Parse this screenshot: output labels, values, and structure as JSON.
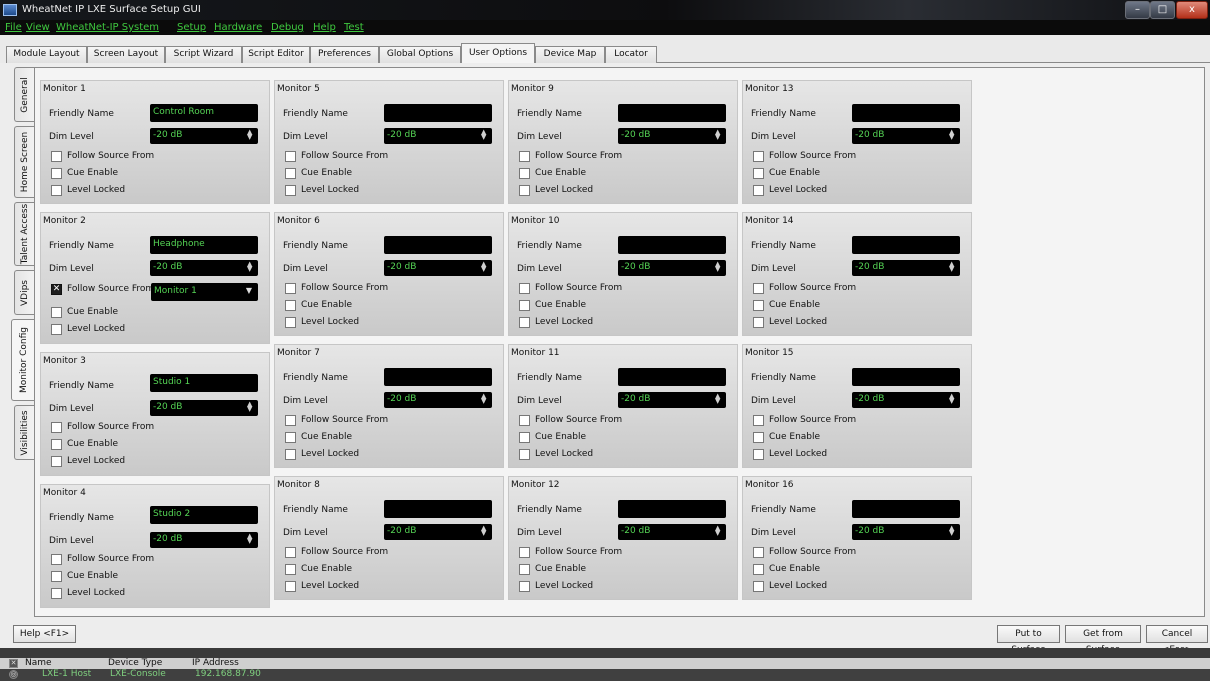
{
  "window": {
    "title": "WheatNet IP LXE Surface Setup GUI",
    "min_glyph": "–",
    "max_glyph": "□",
    "close_glyph": "x"
  },
  "menu": [
    "File",
    "View",
    "WheatNet-IP System",
    "Setup",
    "Hardware",
    "Debug",
    "Help",
    "Test"
  ],
  "tabs": [
    {
      "label": "Module Layout",
      "active": false
    },
    {
      "label": "Screen Layout",
      "active": false
    },
    {
      "label": "Script Wizard",
      "active": false
    },
    {
      "label": "Script Editor",
      "active": false
    },
    {
      "label": "Preferences",
      "active": false
    },
    {
      "label": "Global Options",
      "active": false
    },
    {
      "label": "User Options",
      "active": true
    },
    {
      "label": "Device Map",
      "active": false
    },
    {
      "label": "Locator",
      "active": false
    }
  ],
  "side_tabs": [
    {
      "label": "General",
      "active": false
    },
    {
      "label": "Home Screen",
      "active": false
    },
    {
      "label": "Talent Access",
      "active": false
    },
    {
      "label": "VDips",
      "active": false
    },
    {
      "label": "Monitor Config",
      "active": true
    },
    {
      "label": "Visibilities",
      "active": false
    }
  ],
  "labels": {
    "friendly_name": "Friendly Name",
    "dim_level": "Dim Level",
    "follow_source": "Follow Source From",
    "cue_enable": "Cue Enable",
    "level_locked": "Level Locked"
  },
  "monitors": [
    {
      "title": "Monitor 1",
      "friendly_name": "Control Room",
      "dim_level": "-20 dB",
      "follow_source": false,
      "cue_enable": false,
      "level_locked": false
    },
    {
      "title": "Monitor 2",
      "friendly_name": "Headphone",
      "dim_level": "-20 dB",
      "follow_source": true,
      "follow_source_value": "Monitor 1",
      "cue_enable": false,
      "level_locked": false
    },
    {
      "title": "Monitor 3",
      "friendly_name": "Studio 1",
      "dim_level": "-20 dB",
      "follow_source": false,
      "cue_enable": false,
      "level_locked": false
    },
    {
      "title": "Monitor 4",
      "friendly_name": "Studio 2",
      "dim_level": "-20 dB",
      "follow_source": false,
      "cue_enable": false,
      "level_locked": false
    },
    {
      "title": "Monitor 5",
      "friendly_name": "",
      "dim_level": "-20 dB",
      "follow_source": false,
      "cue_enable": false,
      "level_locked": false
    },
    {
      "title": "Monitor 6",
      "friendly_name": "",
      "dim_level": "-20 dB",
      "follow_source": false,
      "cue_enable": false,
      "level_locked": false
    },
    {
      "title": "Monitor 7",
      "friendly_name": "",
      "dim_level": "-20 dB",
      "follow_source": false,
      "cue_enable": false,
      "level_locked": false
    },
    {
      "title": "Monitor 8",
      "friendly_name": "",
      "dim_level": "-20 dB",
      "follow_source": false,
      "cue_enable": false,
      "level_locked": false
    },
    {
      "title": "Monitor 9",
      "friendly_name": "",
      "dim_level": "-20 dB",
      "follow_source": false,
      "cue_enable": false,
      "level_locked": false
    },
    {
      "title": "Monitor 10",
      "friendly_name": "",
      "dim_level": "-20 dB",
      "follow_source": false,
      "cue_enable": false,
      "level_locked": false
    },
    {
      "title": "Monitor 11",
      "friendly_name": "",
      "dim_level": "-20 dB",
      "follow_source": false,
      "cue_enable": false,
      "level_locked": false
    },
    {
      "title": "Monitor 12",
      "friendly_name": "",
      "dim_level": "-20 dB",
      "follow_source": false,
      "cue_enable": false,
      "level_locked": false
    },
    {
      "title": "Monitor 13",
      "friendly_name": "",
      "dim_level": "-20 dB",
      "follow_source": false,
      "cue_enable": false,
      "level_locked": false
    },
    {
      "title": "Monitor 14",
      "friendly_name": "",
      "dim_level": "-20 dB",
      "follow_source": false,
      "cue_enable": false,
      "level_locked": false
    },
    {
      "title": "Monitor 15",
      "friendly_name": "",
      "dim_level": "-20 dB",
      "follow_source": false,
      "cue_enable": false,
      "level_locked": false
    },
    {
      "title": "Monitor 16",
      "friendly_name": "",
      "dim_level": "-20 dB",
      "follow_source": false,
      "cue_enable": false,
      "level_locked": false
    }
  ],
  "footer": {
    "help": "Help <F1>",
    "put": "Put to Surface",
    "get": "Get from Surface",
    "cancel": "Cancel <Esc>"
  },
  "status": {
    "headers": {
      "name": "Name",
      "device_type": "Device Type",
      "ip": "IP Address"
    },
    "row": {
      "name": "LXE-1 Host",
      "device_type": "LXE-Console",
      "ip": "192.168.87.90"
    }
  }
}
